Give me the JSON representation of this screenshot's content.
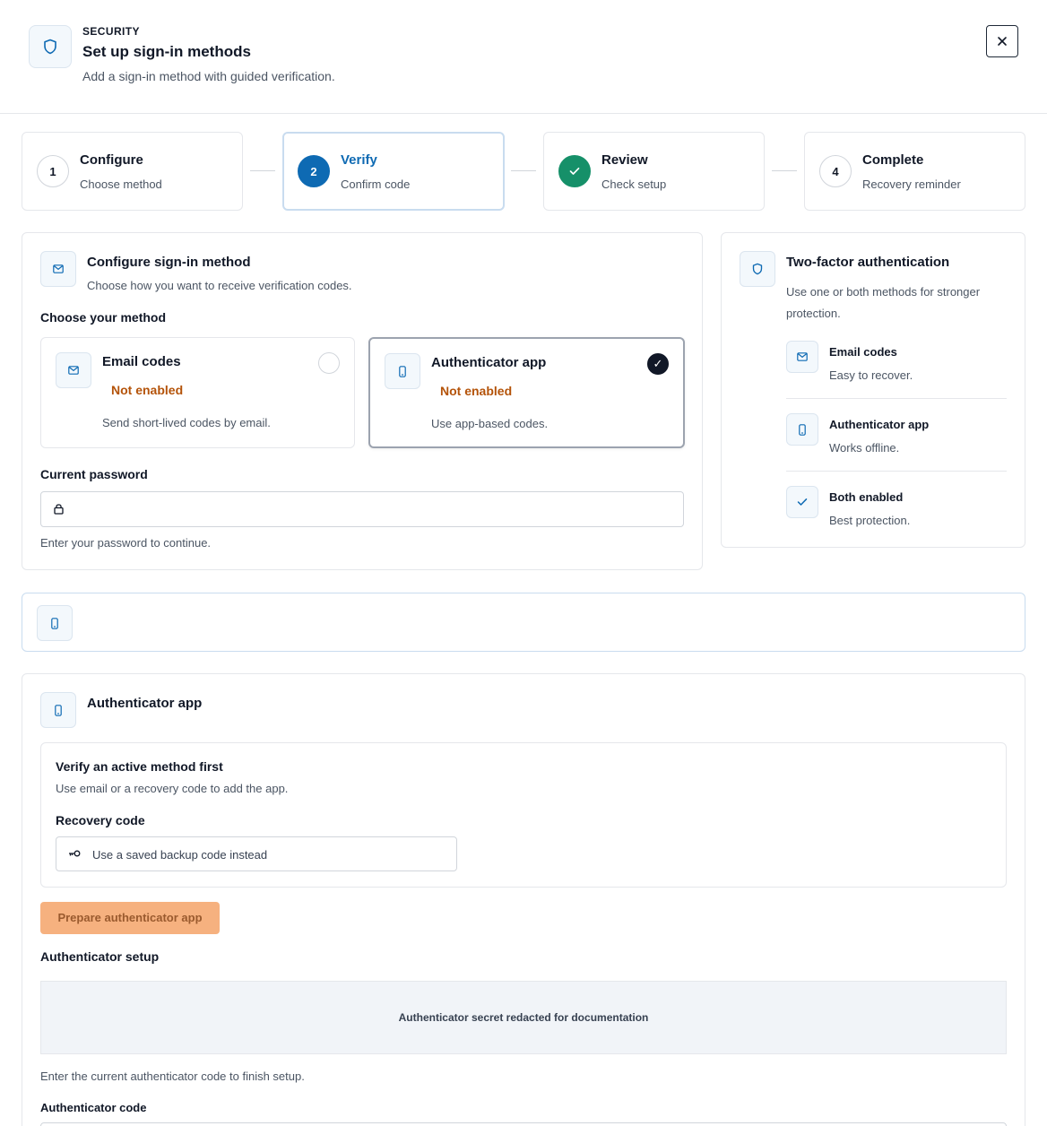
{
  "header": {
    "eyebrow": "SECURITY",
    "title": "Set up sign-in methods",
    "subtitle": "Add a sign-in method with guided verification."
  },
  "stepper": [
    {
      "number": "1",
      "title": "Configure",
      "subtitle": "Choose method",
      "state": "pending"
    },
    {
      "number": "2",
      "title": "Verify",
      "subtitle": "Confirm code",
      "state": "current"
    },
    {
      "number": "",
      "title": "Review",
      "subtitle": "Check setup",
      "state": "done"
    },
    {
      "number": "4",
      "title": "Complete",
      "subtitle": "Recovery reminder",
      "state": "pending"
    }
  ],
  "configure": {
    "title": "Configure sign-in method",
    "subtitle": "Choose how you want to receive verification codes.",
    "choose_label": "Choose your method",
    "methods": [
      {
        "name": "Email codes",
        "status": "Not enabled",
        "description": "Send short-lived codes by email.",
        "selected": false
      },
      {
        "name": "Authenticator app",
        "status": "Not enabled",
        "description": "Use app-based codes.",
        "selected": true
      }
    ],
    "password_label": "Current password",
    "password_value": "",
    "password_help": "Enter your password to continue.",
    "checkmark": "✓"
  },
  "twofa": {
    "title": "Two-factor authentication",
    "subtitle": "Use one or both methods for stronger protection.",
    "items": [
      {
        "title": "Email codes",
        "subtitle": "Easy to recover."
      },
      {
        "title": "Authenticator app",
        "subtitle": "Works offline."
      },
      {
        "title": "Both enabled",
        "subtitle": "Best protection."
      }
    ]
  },
  "authenticator": {
    "title": "Authenticator app",
    "verify_title": "Verify an active method first",
    "verify_subtitle": "Use email or a recovery code to add the app.",
    "recovery_label": "Recovery code",
    "recovery_placeholder": "Use a saved backup code instead",
    "prepare_button": "Prepare authenticator app",
    "setup_title": "Authenticator setup",
    "secret_text": "Authenticator secret redacted for documentation",
    "finish_hint": "Enter the current authenticator code to finish setup.",
    "code_label": "Authenticator code"
  },
  "colors": {
    "accent": "#0e6ab3",
    "success": "#169069",
    "warning_text": "#b45309",
    "button_disabled": "#f6b17f"
  },
  "icons": {
    "header": "shield-icon",
    "close": "close-icon",
    "email": "mail-icon",
    "app": "phone-icon",
    "lock": "lock-icon",
    "key": "key-icon",
    "check": "check-icon"
  }
}
